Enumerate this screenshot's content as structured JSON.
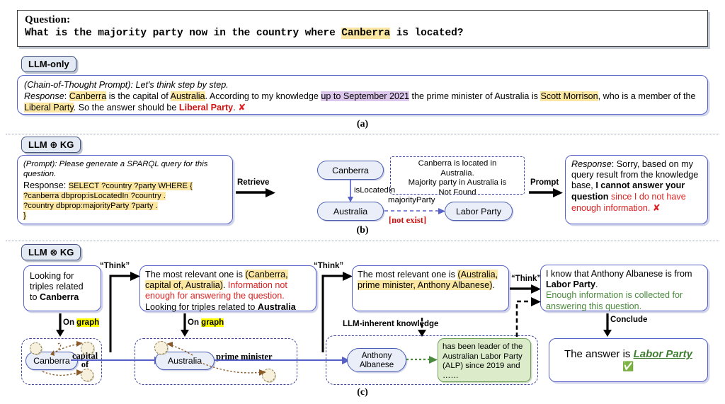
{
  "question": {
    "label": "Question:",
    "text_before": "What is the majority party now in the country where ",
    "highlight": "Canberra",
    "text_after": " is located?"
  },
  "sections": {
    "a": {
      "badge": "LLM-only",
      "caption": "(a)",
      "prompt_italic": "(Chain-of-Thought Prompt): Let's think step by step.",
      "response_label": "Response",
      "r1": "Canberra",
      "r2": " is the capital of ",
      "r3": "Australia",
      "r4": ". According to my knowledge ",
      "r5": "up to September 2021",
      "r6": " the prime minister of Australia is ",
      "r7": "Scott Morrison",
      "r8": ", who is a member of the ",
      "r9": "Liberal Party",
      "r10": ". So the answer should be ",
      "r11": "Liberal Party",
      "r12": ".",
      "cross": "✘"
    },
    "b": {
      "badge": "LLM ⊕ KG",
      "caption": "(b)",
      "prompt_italic": "(Prompt): Please generate a SPARQL query for this question.",
      "response_label": "Response: ",
      "sparql_l1": "SELECT ?country ?party WHERE {",
      "sparql_l2": "?canberra dbprop:isLocatedIn ?country .",
      "sparql_l3": "?country dbprop:majorityParty ?party .",
      "sparql_l4": "}",
      "arrow_retrieve": "Retrieve",
      "arrow_prompt": "Prompt",
      "node_canberra": "Canberra",
      "node_australia": "Australia",
      "node_labor": "Labor Party",
      "edge_islocatedin": "isLocatedIn",
      "edge_majorityparty": "majorityParty",
      "not_exist": "[not exist]",
      "result_l1": "Canberra is located in",
      "result_l2": "Australia.",
      "result_l3": "Majority party in Australia is",
      "result_l4": "Not Found",
      "resp_label": "Response",
      "resp_t1": ": Sorry, based on my query result from the knowledge base, ",
      "resp_bold": "I cannot answer your question",
      "resp_red": " since I do not have enough information.",
      "cross": "✘"
    },
    "c": {
      "badge": "LLM ⊗ KG",
      "caption": "(c)",
      "box1_l1": "Looking for",
      "box1_l2": "triples related",
      "box1_l3": "to ",
      "box1_bold": "Canberra",
      "think": "“Think”",
      "on_graph_pre": "On ",
      "on_graph_hl": "graph",
      "box2_t1": "The most relevant one is ",
      "box2_hl1": "(Canberra,",
      "box2_hl2": "capital of, Australia)",
      "box2_t2": ". ",
      "box2_red": "Information not enough for answering the question.",
      "box2_t3": "Looking for triples related to ",
      "box2_bold": "Australia",
      "box3_t1": "The most relevant one is ",
      "box3_hl1": "(Australia,",
      "box3_hl2": "prime minister, Anthony Albanese)",
      "box3_t2": ".",
      "box4_t1": "I know that Anthony Albanese is from ",
      "box4_bold": "Labor Party",
      "box4_t2": ".",
      "box4_green": "Enough information is collected for answering this question.",
      "llm_inherent": "LLM-inherent knowledge",
      "conclude": "Conclude",
      "node_canberra": "Canberra",
      "node_australia": "Australia",
      "node_anthony_l1": "Anthony",
      "node_anthony_l2": "Albanese",
      "edge_capital_l1": "capital",
      "edge_capital_l2": "of",
      "edge_pm": "prime minister",
      "green_note": "has been leader of the Australian Labor Party (ALP) since 2019 and ……",
      "answer_pre": "The answer is ",
      "answer_val": "Labor Party",
      "check": "✅"
    }
  },
  "colors": {
    "accent_blue": "#5560c8",
    "badge_fill": "#e4eaf4",
    "highlight_yellow": "#fbe6a2",
    "highlight_bright": "#ffff00",
    "highlight_purple": "#dcc6ec",
    "error_red": "#e02020",
    "success_green": "#4a8a3c"
  }
}
